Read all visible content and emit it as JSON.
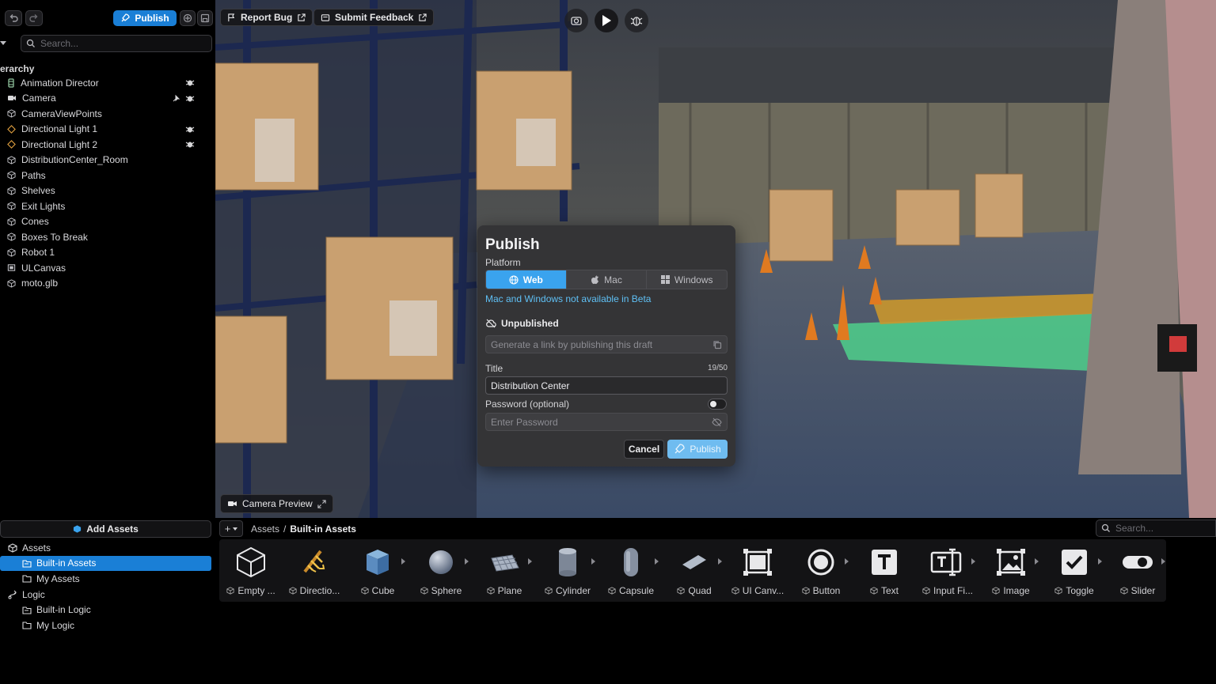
{
  "toolbar": {
    "publish_label": "Publish",
    "report_bug_label": "Report Bug",
    "submit_feedback_label": "Submit Feedback"
  },
  "hierarchy": {
    "search_placeholder": "Search...",
    "title": "erarchy",
    "items": [
      {
        "label": "Animation Director",
        "icon": "animation-icon"
      },
      {
        "label": "Camera",
        "icon": "camera-icon"
      },
      {
        "label": "CameraViewPoints",
        "icon": "object-icon"
      },
      {
        "label": "Directional Light 1",
        "icon": "light-icon"
      },
      {
        "label": "Directional Light 2",
        "icon": "light-icon"
      },
      {
        "label": "DistributionCenter_Room",
        "icon": "object-icon"
      },
      {
        "label": "Paths",
        "icon": "object-icon"
      },
      {
        "label": "Shelves",
        "icon": "object-icon"
      },
      {
        "label": "Exit Lights",
        "icon": "object-icon"
      },
      {
        "label": "Cones",
        "icon": "object-icon"
      },
      {
        "label": "Boxes To Break",
        "icon": "object-icon"
      },
      {
        "label": "Robot 1",
        "icon": "object-icon"
      },
      {
        "label": "ULCanvas",
        "icon": "canvas-icon"
      },
      {
        "label": "moto.glb",
        "icon": "object-icon"
      }
    ]
  },
  "viewport": {
    "camera_preview_label": "Camera Preview"
  },
  "publish_dialog": {
    "title": "Publish",
    "platform_label": "Platform",
    "platforms": [
      "Web",
      "Mac",
      "Windows"
    ],
    "selected_platform": "Web",
    "beta_note": "Mac and Windows not available in Beta",
    "status": "Unpublished",
    "link_placeholder": "Generate a link by publishing this draft",
    "title_label": "Title",
    "title_counter": "19/50",
    "title_value": "Distribution Center",
    "password_label": "Password (optional)",
    "password_placeholder": "Enter Password",
    "cancel_label": "Cancel",
    "publish_label": "Publish",
    "accent_color": "#3aa3ee"
  },
  "assets_panel": {
    "add_assets_label": "Add Assets",
    "tree": [
      {
        "label": "Assets",
        "level": 0,
        "icon": "package-icon"
      },
      {
        "label": "Built-in Assets",
        "level": 1,
        "icon": "folder-icon",
        "selected": true
      },
      {
        "label": "My Assets",
        "level": 1,
        "icon": "folder-icon"
      },
      {
        "label": "Logic",
        "level": 0,
        "icon": "logic-icon"
      },
      {
        "label": "Built-in Logic",
        "level": 1,
        "icon": "folder-icon"
      },
      {
        "label": "My Logic",
        "level": 1,
        "icon": "folder-icon"
      }
    ],
    "breadcrumb": [
      "Assets",
      "Built-in Assets"
    ],
    "search_placeholder": "Search...",
    "items": [
      {
        "label": "Empty ...",
        "icon": "cube-outline-icon"
      },
      {
        "label": "Directio...",
        "icon": "directional-light-icon"
      },
      {
        "label": "Cube",
        "icon": "cube-icon"
      },
      {
        "label": "Sphere",
        "icon": "sphere-icon"
      },
      {
        "label": "Plane",
        "icon": "plane-icon"
      },
      {
        "label": "Cylinder",
        "icon": "cylinder-icon"
      },
      {
        "label": "Capsule",
        "icon": "capsule-icon"
      },
      {
        "label": "Quad",
        "icon": "quad-icon"
      },
      {
        "label": "UI Canv...",
        "icon": "ui-canvas-icon"
      },
      {
        "label": "Button",
        "icon": "button-icon"
      },
      {
        "label": "Text",
        "icon": "text-icon"
      },
      {
        "label": "Input Fi...",
        "icon": "input-field-icon"
      },
      {
        "label": "Image",
        "icon": "image-icon"
      },
      {
        "label": "Toggle",
        "icon": "toggle-icon"
      },
      {
        "label": "Slider",
        "icon": "slider-icon"
      }
    ]
  }
}
